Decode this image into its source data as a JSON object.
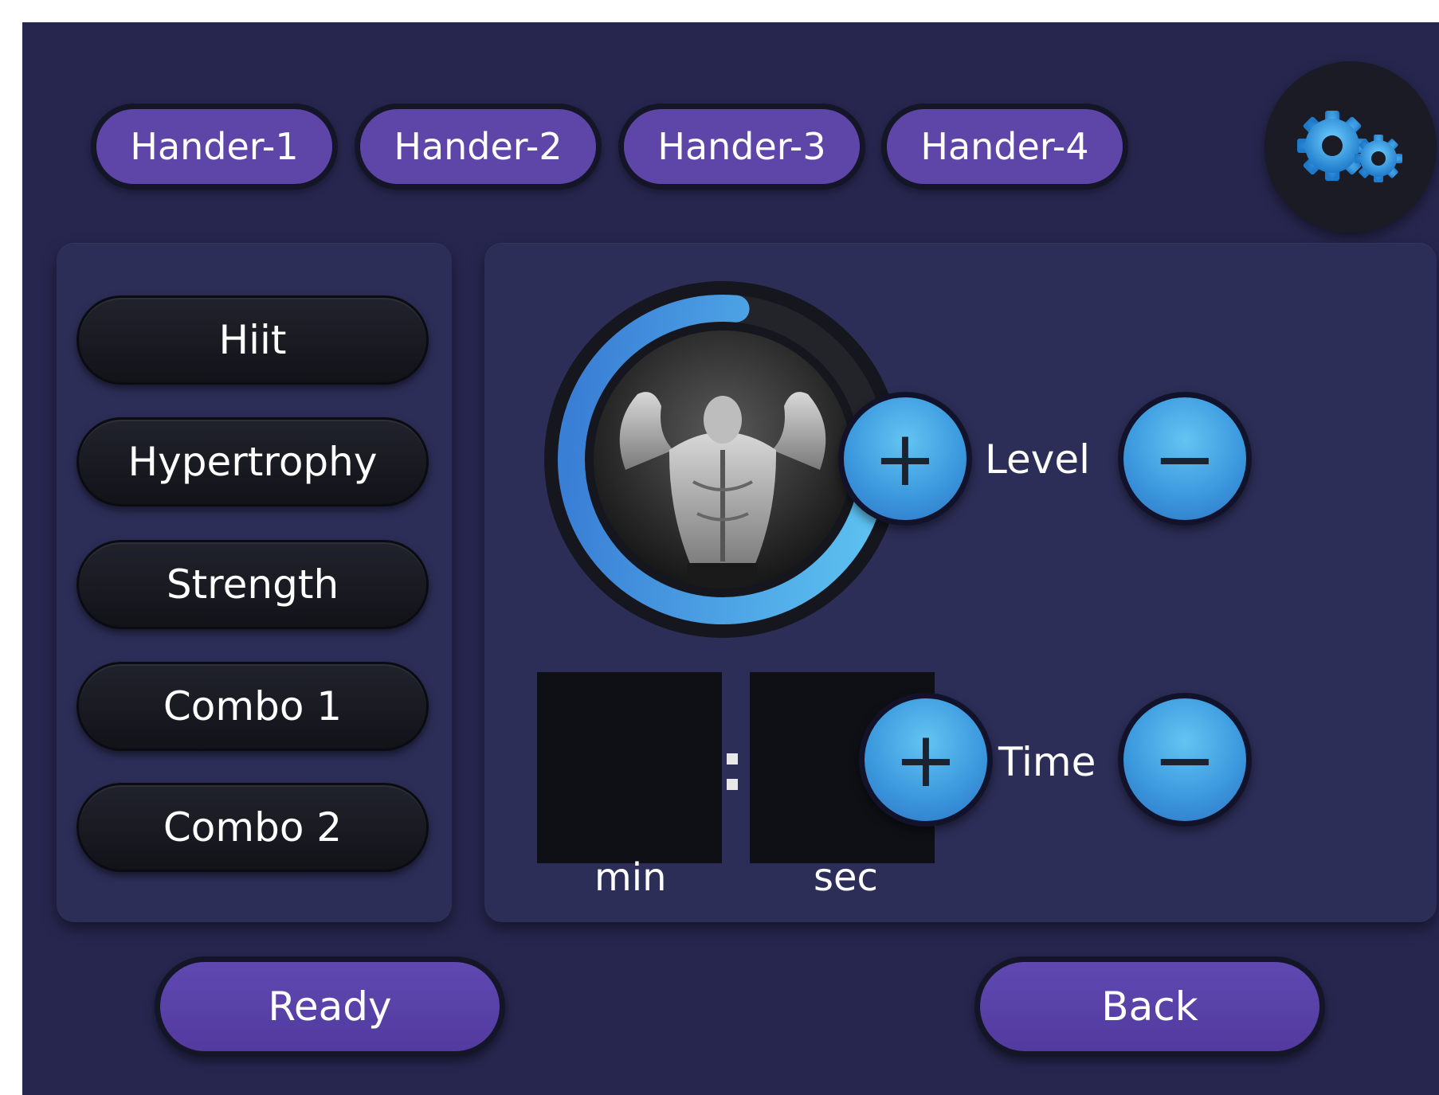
{
  "tabs": [
    "Hander-1",
    "Hander-2",
    "Hander-3",
    "Hander-4"
  ],
  "settings_icon": "gears-icon",
  "modes": [
    "Hiit",
    "Hypertrophy",
    "Strength",
    "Combo 1",
    "Combo 2"
  ],
  "level": {
    "label": "Level",
    "plus": "+",
    "minus": "−"
  },
  "time": {
    "label": "Time",
    "plus": "+",
    "minus": "−",
    "min_unit": "min",
    "sec_unit": "sec",
    "minutes": "",
    "seconds": ""
  },
  "progress_ring": {
    "fraction": 0.78,
    "color": "#4aa6e6",
    "track": "#23232a"
  },
  "buttons": {
    "ready": "Ready",
    "back": "Back"
  },
  "colors": {
    "background": "#27264f",
    "panel": "#2d2e58",
    "tab": "#5e46a9",
    "accent": "#4aa6e6"
  }
}
